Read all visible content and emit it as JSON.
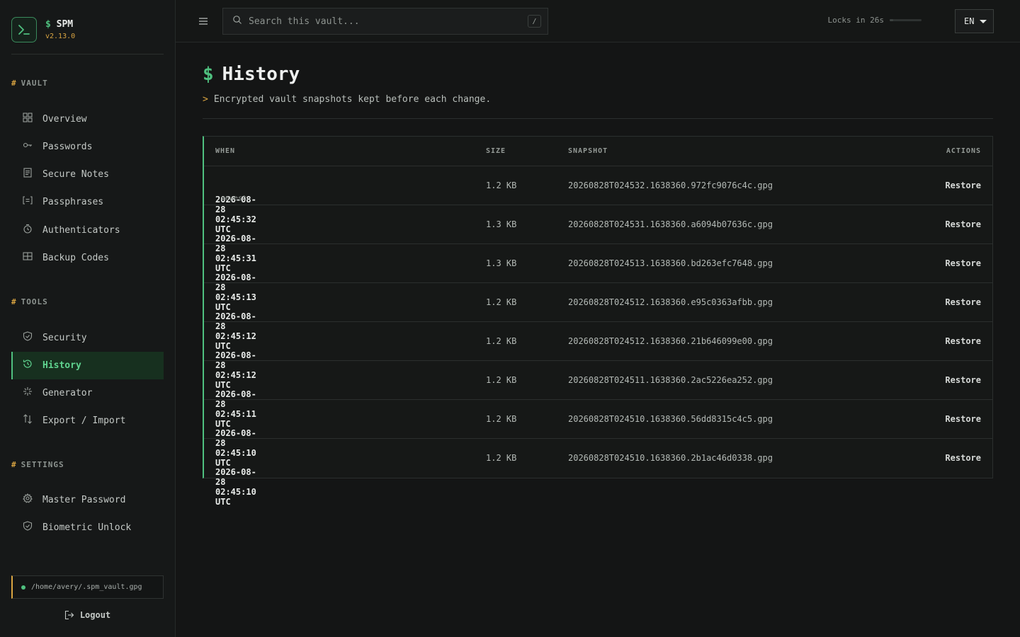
{
  "brand": {
    "prompt": "$",
    "name": "SPM",
    "version": "v2.13.0"
  },
  "sidebar": {
    "sections": [
      {
        "label": "VAULT"
      },
      {
        "label": "TOOLS"
      },
      {
        "label": "SETTINGS"
      }
    ],
    "vault_items": [
      {
        "label": "Overview",
        "icon": "grid-icon"
      },
      {
        "label": "Passwords",
        "icon": "key-icon"
      },
      {
        "label": "Secure Notes",
        "icon": "note-icon"
      },
      {
        "label": "Passphrases",
        "icon": "bracket-icon"
      },
      {
        "label": "Authenticators",
        "icon": "timer-icon"
      },
      {
        "label": "Backup Codes",
        "icon": "table-icon"
      }
    ],
    "tools_items": [
      {
        "label": "Security",
        "icon": "shield-icon"
      },
      {
        "label": "History",
        "icon": "history-icon",
        "active": true
      },
      {
        "label": "Generator",
        "icon": "sparkle-icon"
      },
      {
        "label": "Export / Import",
        "icon": "arrows-icon"
      }
    ],
    "settings_items": [
      {
        "label": "Master Password",
        "icon": "gear-icon"
      },
      {
        "label": "Biometric Unlock",
        "icon": "shield-check-icon"
      }
    ],
    "vault_path": "/home/avery/.spm_vault.gpg",
    "logout_label": "Logout"
  },
  "topbar": {
    "search_placeholder": "Search this vault...",
    "search_shortcut": "/",
    "lock_text": "Locks in 26s",
    "lock_remaining_fraction": 0.1,
    "language": "EN"
  },
  "page": {
    "prompt": "$",
    "title": "History",
    "subtitle_prompt": ">",
    "subtitle": "Encrypted vault snapshots kept before each change."
  },
  "table": {
    "headers": {
      "when": "WHEN",
      "size": "SIZE",
      "snapshot": "SNAPSHOT",
      "actions": "ACTIONS"
    },
    "rows": [
      {
        "when": "2026-08-28 02:45:32 UTC",
        "tag": "newest",
        "size": "1.2 KB",
        "snapshot": "20260828T024532.1638360.972fc9076c4c.gpg",
        "action": "Restore"
      },
      {
        "when": "2026-08-28 02:45:31 UTC",
        "tag": "",
        "size": "1.3 KB",
        "snapshot": "20260828T024531.1638360.a6094b07636c.gpg",
        "action": "Restore"
      },
      {
        "when": "2026-08-28 02:45:13 UTC",
        "tag": "",
        "size": "1.3 KB",
        "snapshot": "20260828T024513.1638360.bd263efc7648.gpg",
        "action": "Restore"
      },
      {
        "when": "2026-08-28 02:45:12 UTC",
        "tag": "",
        "size": "1.2 KB",
        "snapshot": "20260828T024512.1638360.e95c0363afbb.gpg",
        "action": "Restore"
      },
      {
        "when": "2026-08-28 02:45:12 UTC",
        "tag": "",
        "size": "1.2 KB",
        "snapshot": "20260828T024512.1638360.21b646099e00.gpg",
        "action": "Restore"
      },
      {
        "when": "2026-08-28 02:45:11 UTC",
        "tag": "",
        "size": "1.2 KB",
        "snapshot": "20260828T024511.1638360.2ac5226ea252.gpg",
        "action": "Restore"
      },
      {
        "when": "2026-08-28 02:45:10 UTC",
        "tag": "",
        "size": "1.2 KB",
        "snapshot": "20260828T024510.1638360.56dd8315c4c5.gpg",
        "action": "Restore"
      },
      {
        "when": "2026-08-28 02:45:10 UTC",
        "tag": "",
        "size": "1.2 KB",
        "snapshot": "20260828T024510.1638360.2b1ac46d0338.gpg",
        "action": "Restore"
      }
    ]
  },
  "colors": {
    "accent": "#4fc07f",
    "warning": "#d9a441",
    "background": "#141515"
  }
}
